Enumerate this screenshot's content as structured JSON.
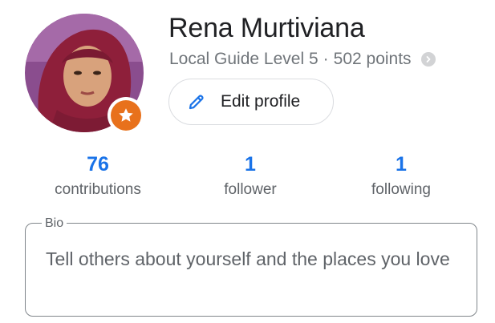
{
  "profile": {
    "name": "Rena Murtiviana",
    "guide_level": "Local Guide Level 5",
    "separator": "·",
    "points": "502 points",
    "edit_button_label": "Edit profile",
    "badge_icon": "star-icon",
    "info_icon": "chevron-right-icon"
  },
  "stats": [
    {
      "value": "76",
      "label": "contributions"
    },
    {
      "value": "1",
      "label": "follower"
    },
    {
      "value": "1",
      "label": "following"
    }
  ],
  "bio": {
    "label": "Bio",
    "placeholder": "Tell others about yourself and the places you love"
  },
  "colors": {
    "accent": "#1a73e8",
    "badge": "#e8711c",
    "secondary_text": "#5f6368"
  }
}
